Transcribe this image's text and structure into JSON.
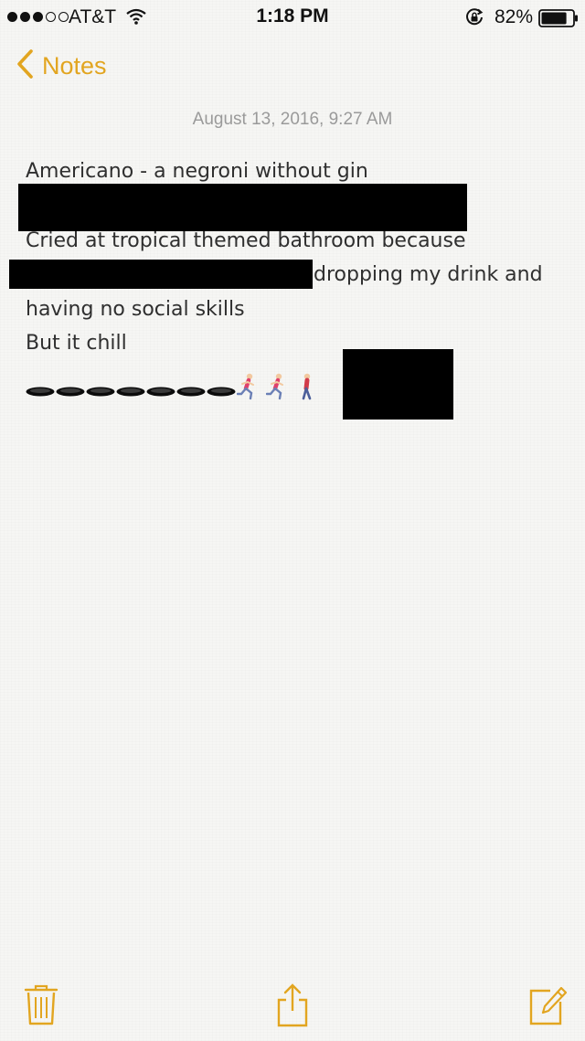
{
  "status_bar": {
    "carrier": "AT&T",
    "signal_bars": 3,
    "signal_total": 5,
    "time": "1:18 PM",
    "battery_percent": "82%",
    "battery_level": 0.82
  },
  "nav": {
    "back_label": "Notes",
    "accent_color": "#e2a520"
  },
  "note": {
    "date": "August 13, 2016, 9:27 AM",
    "lines": [
      "Americano - a negroni without gin",
      "Cried at tropical themed bathroom because",
      "dropping my drink and",
      "having no social skills",
      "But it chill"
    ],
    "emoji_row": {
      "holes": 7,
      "runners": 2,
      "walkers": 1
    }
  },
  "toolbar": {
    "icons": [
      "trash-icon",
      "share-icon",
      "compose-icon"
    ]
  }
}
